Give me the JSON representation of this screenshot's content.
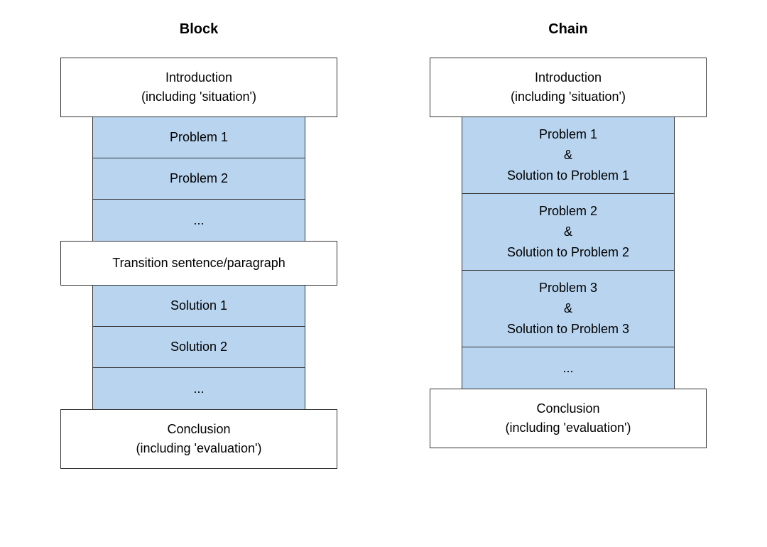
{
  "left": {
    "header": "Block",
    "intro_line1": "Introduction",
    "intro_line2": "(including 'situation')",
    "problem1": "Problem 1",
    "problem2": "Problem 2",
    "ellipsis1": "...",
    "transition": "Transition sentence/paragraph",
    "solution1": "Solution 1",
    "solution2": "Solution 2",
    "ellipsis2": "...",
    "conclusion_line1": "Conclusion",
    "conclusion_line2": "(including 'evaluation')"
  },
  "right": {
    "header": "Chain",
    "intro_line1": "Introduction",
    "intro_line2": "(including 'situation')",
    "pair1_l1": "Problem 1",
    "pair1_l2": "&",
    "pair1_l3": "Solution to Problem 1",
    "pair2_l1": "Problem 2",
    "pair2_l2": "&",
    "pair2_l3": "Solution to Problem 2",
    "pair3_l1": "Problem 3",
    "pair3_l2": "&",
    "pair3_l3": "Solution to Problem 3",
    "ellipsis": "...",
    "conclusion_line1": "Conclusion",
    "conclusion_line2": "(including 'evaluation')"
  }
}
